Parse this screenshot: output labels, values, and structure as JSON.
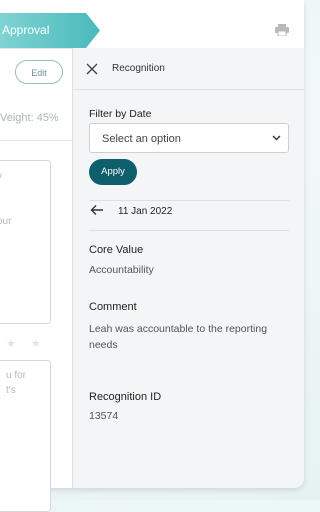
{
  "header": {
    "approval_step": "Approval"
  },
  "background_form": {
    "edit_label": "Edit",
    "weight_text": "Veight: 45%",
    "textarea1_line1": "y",
    "textarea1_line2": "our",
    "textarea2_line1": "u for",
    "textarea2_line2": "t's",
    "stars": "★ ★"
  },
  "drawer": {
    "title": "Recognition",
    "filter_label": "Filter by Date",
    "select_placeholder": "Select an option",
    "apply_label": "Apply",
    "current_date": "11 Jan 2022",
    "core_value_label": "Core Value",
    "core_value": "Accountability",
    "comment_label": "Comment",
    "comment": "Leah was accountable to the reporting needs",
    "recognition_id_label": "Recognition ID",
    "recognition_id": "13574"
  },
  "colors": {
    "accent": "#0f5e6b",
    "approval_gradient_start": "#7fd3d3",
    "approval_gradient_end": "#49b9bb"
  },
  "icons": [
    "print-icon",
    "close-icon",
    "chevron-down-icon",
    "arrow-left-icon"
  ]
}
